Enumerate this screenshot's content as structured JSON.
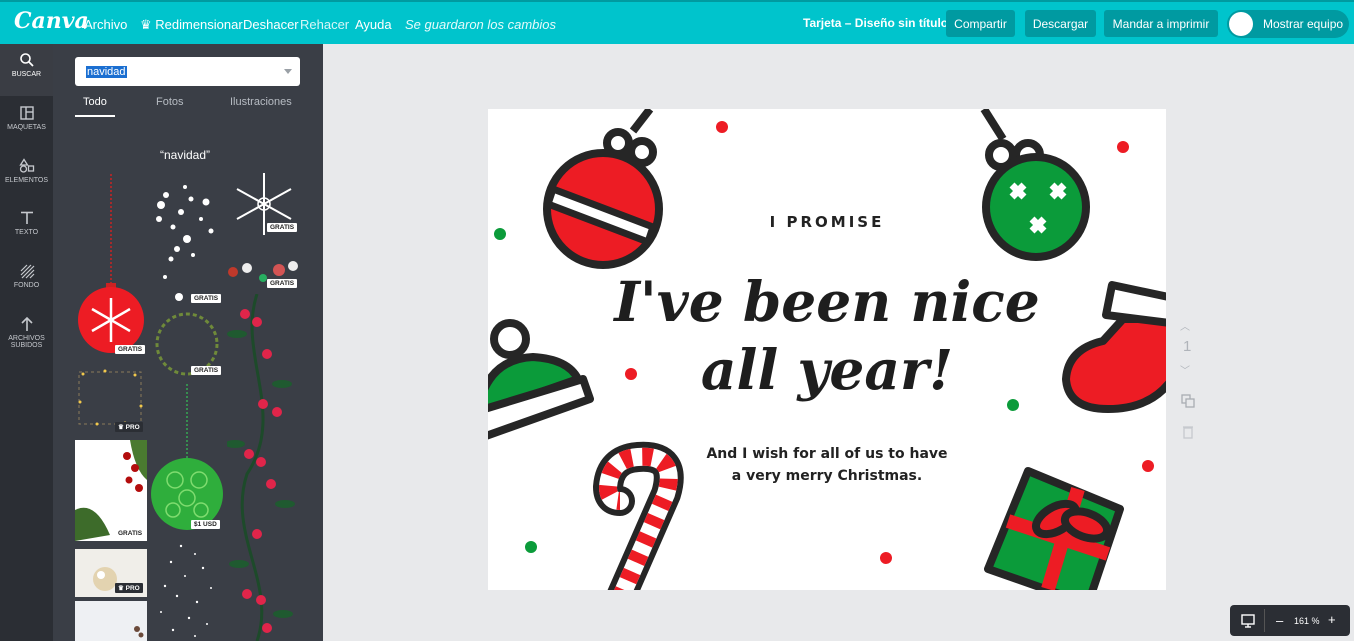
{
  "topbar": {
    "logo": "Canva",
    "menu": {
      "archivo": "Archivo",
      "redimensionar": "♛ Redimensionar",
      "deshacer": "Deshacer",
      "rehacer": "Rehacer",
      "ayuda": "Ayuda"
    },
    "status": "Se guardaron los cambios",
    "doc_title": "Tarjeta – Diseño sin título",
    "buttons": {
      "compartir": "Compartir",
      "descargar": "Descargar",
      "imprimir": "Mandar a imprimir",
      "equipo": "Mostrar equipo"
    }
  },
  "rail": {
    "buscar": "BUSCAR",
    "maquetas": "MAQUETAS",
    "elementos": "ELEMENTOS",
    "texto": "TEXTO",
    "fondo": "FONDO",
    "archivos1": "ARCHIVOS",
    "archivos2": "SUBIDOS"
  },
  "panel": {
    "search_value": "navidad",
    "tabs": {
      "todo": "Todo",
      "fotos": "Fotos",
      "ilustraciones": "Ilustraciones"
    },
    "query_label": "“navidad”",
    "badges": {
      "gratis": "GRATIS",
      "pro": "♛ PRO",
      "usd": "$1 USD"
    }
  },
  "card": {
    "promise": "I PROMISE",
    "line1": "I've been nice",
    "line2": "all year!",
    "wish1": "And I wish for all of us to have",
    "wish2": "a very merry Christmas."
  },
  "page": {
    "number": "1"
  },
  "zoom": {
    "level": "161 %",
    "minus": "–",
    "plus": "+"
  },
  "colors": {
    "accent": "#00c4cc",
    "red": "#ed1c24",
    "green": "#0b9b3a"
  }
}
